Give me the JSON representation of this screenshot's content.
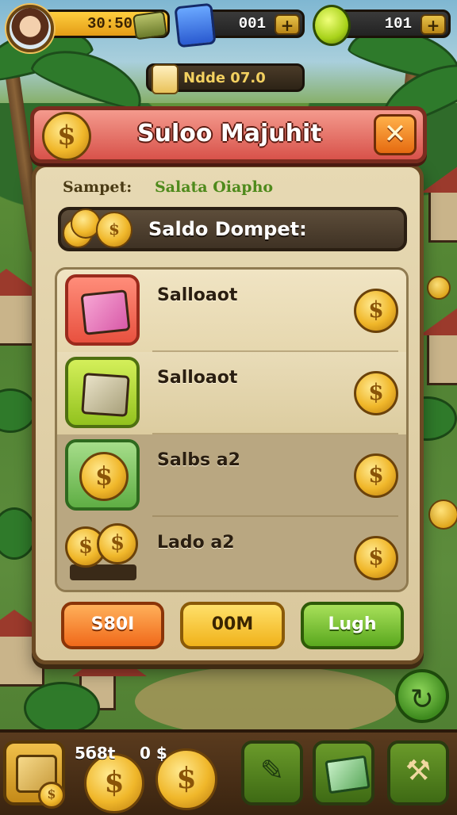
{
  "hud": {
    "gold_value": "30:50",
    "gem_value": "001",
    "lime_value": "101",
    "plus_label": "+",
    "level_text": "Ndde 07.0"
  },
  "modal": {
    "title": "Suloo Majuhit",
    "close_label": "✕",
    "coin_glyph": "$",
    "label_left": "Sampet:",
    "label_right": "Salata Oiapho",
    "wallet_label": "Saldo Dompet:",
    "items": [
      {
        "label": "Salloaot",
        "icon": "pink-box-icon"
      },
      {
        "label": "Salloaot",
        "icon": "cash-box-icon"
      },
      {
        "label": "Salbs a2",
        "icon": "single-coin-icon"
      },
      {
        "label": "Lado a2",
        "icon": "coin-pile-icon"
      }
    ],
    "buttons": {
      "orange": "S80I",
      "yellow": "00M",
      "green": "Lugh"
    }
  },
  "bottom": {
    "counter_a": "5б8t",
    "counter_b": "0 $"
  },
  "colors": {
    "gold": "#f0b72a",
    "title_red": "#d8524a",
    "panel": "#e7d9b3",
    "btn_green": "#5aa81e"
  }
}
